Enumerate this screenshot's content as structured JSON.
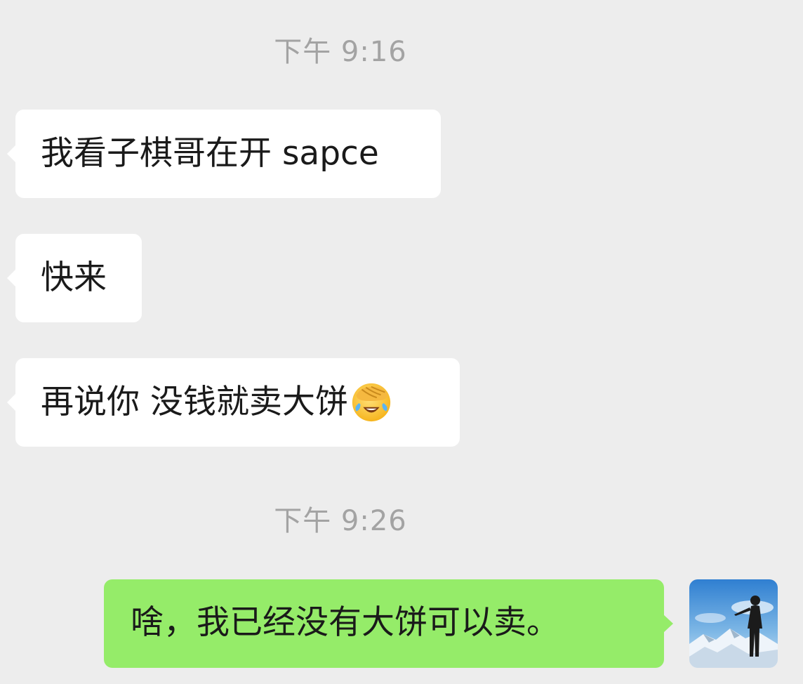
{
  "chat": {
    "timestamps": [
      "下午 9:16",
      "下午 9:26"
    ],
    "messages": [
      {
        "side": "received",
        "text": "我看子棋哥在开 sapce"
      },
      {
        "side": "received",
        "text": "快来"
      },
      {
        "side": "received",
        "text": "再说你 没钱就卖大饼",
        "emoji": "facepalm-laughing-icon"
      },
      {
        "side": "sent",
        "text": "啥，我已经没有大饼可以卖。"
      }
    ]
  },
  "colors": {
    "background": "#ededed",
    "received_bubble": "#ffffff",
    "sent_bubble": "#95ec69",
    "timestamp_text": "#a3a3a3",
    "message_text": "#1a1a1a"
  },
  "avatar": {
    "icon": "user-avatar-icon"
  }
}
